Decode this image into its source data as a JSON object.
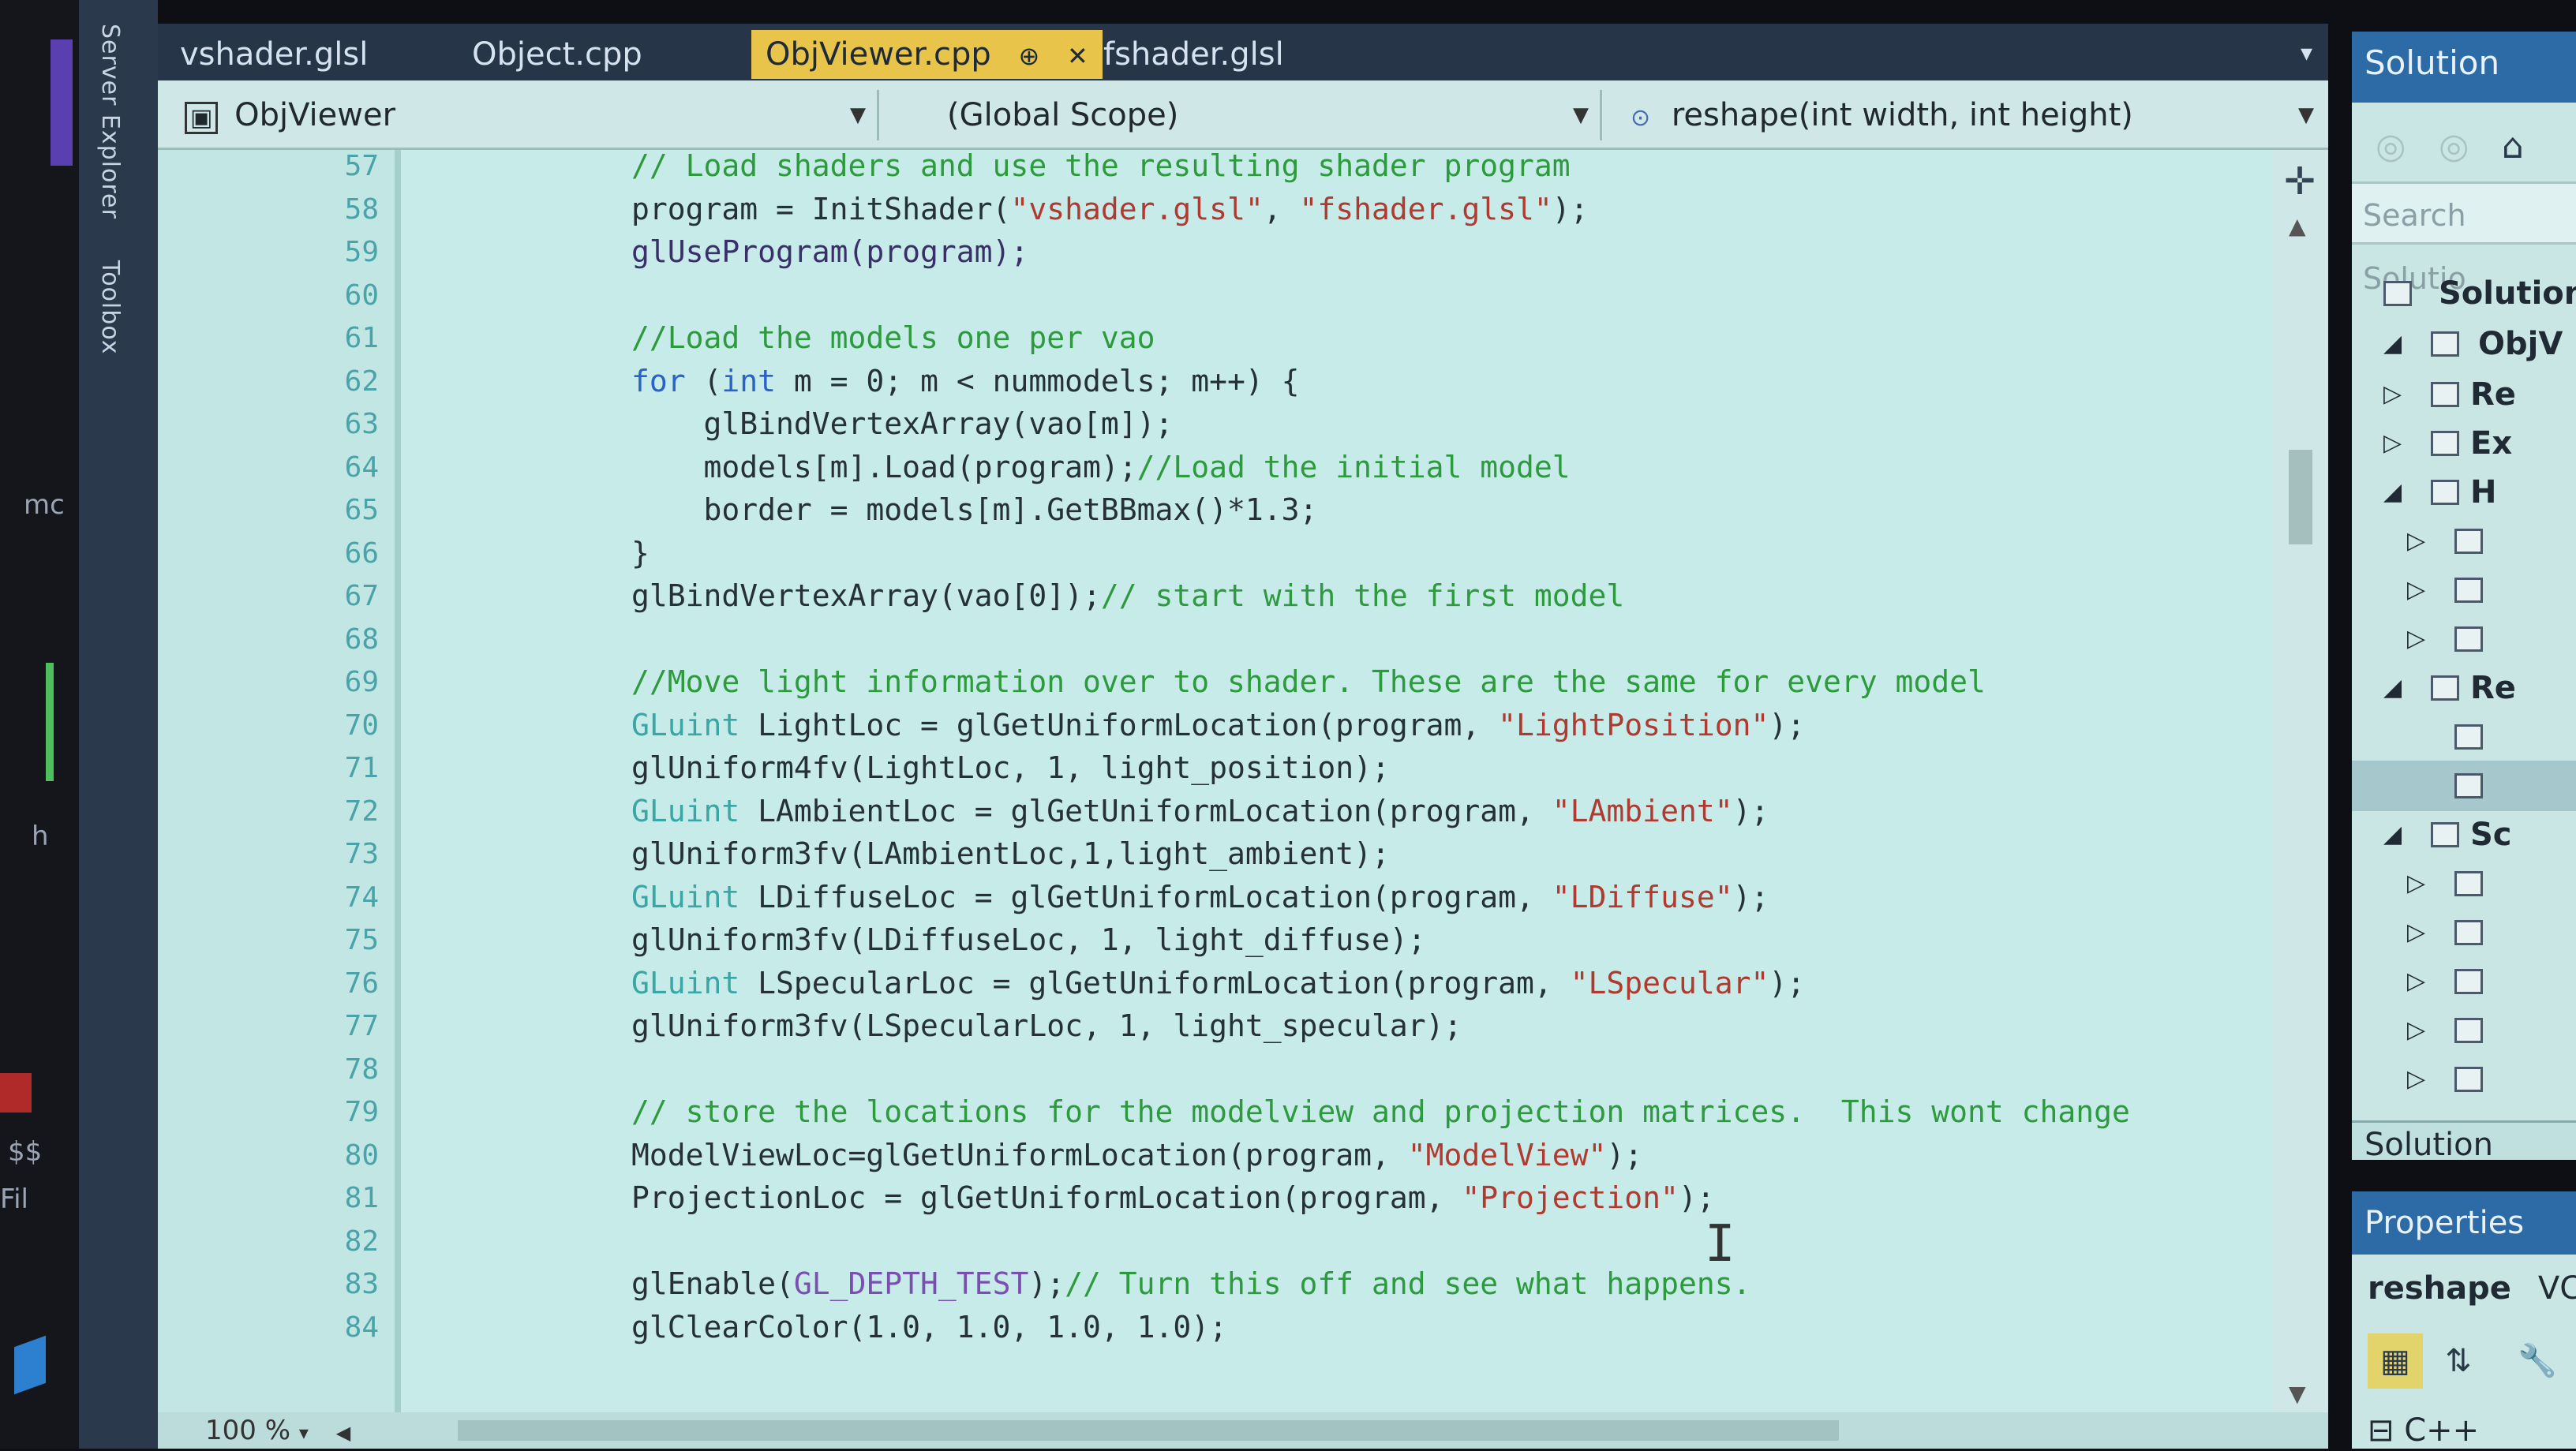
{
  "left_strip": {
    "text_mc": "mc",
    "text_h": "h",
    "text_ss": "$$",
    "text_fil": "Fil"
  },
  "side_tabs": {
    "server_explorer": "Server Explorer",
    "toolbox": "Toolbox"
  },
  "tabs": [
    {
      "label": "vshader.glsl"
    },
    {
      "label": "Object.cpp"
    },
    {
      "label": "ObjViewer.cpp",
      "pin": "⊕",
      "close": "✕"
    },
    {
      "label": "fshader.glsl"
    }
  ],
  "tab_overflow": "▾",
  "nav": {
    "project": "ObjViewer",
    "scope": "(Global Scope)",
    "member": "reshape(int width, int height)"
  },
  "editor": {
    "lines": [
      {
        "num": "57",
        "segments": [
          {
            "t": "// Load shaders and use the resulting shader program",
            "c": "cm"
          }
        ]
      },
      {
        "num": "58",
        "segments": [
          {
            "t": "program = InitShader(",
            "c": ""
          },
          {
            "t": "\"vshader.glsl\"",
            "c": "st"
          },
          {
            "t": ", ",
            "c": ""
          },
          {
            "t": "\"fshader.glsl\"",
            "c": "st"
          },
          {
            "t": ");",
            "c": ""
          }
        ]
      },
      {
        "num": "59",
        "segments": [
          {
            "t": "glUseProgram(program);",
            "c": "fn"
          }
        ]
      },
      {
        "num": "60",
        "segments": []
      },
      {
        "num": "61",
        "segments": [
          {
            "t": "//Load the models one per vao",
            "c": "cm"
          }
        ]
      },
      {
        "num": "62",
        "segments": [
          {
            "t": "for",
            "c": "kw"
          },
          {
            "t": " (",
            "c": ""
          },
          {
            "t": "int",
            "c": "kw"
          },
          {
            "t": " m = 0; m < nummodels; m++) {",
            "c": ""
          }
        ]
      },
      {
        "num": "63",
        "segments": [
          {
            "t": "    glBindVertexArray(vao[m]);",
            "c": ""
          }
        ]
      },
      {
        "num": "64",
        "segments": [
          {
            "t": "    models[m].Load(program);",
            "c": ""
          },
          {
            "t": "//Load the initial model",
            "c": "cm"
          }
        ]
      },
      {
        "num": "65",
        "segments": [
          {
            "t": "    border = models[m].GetBBmax()*1.3;",
            "c": ""
          }
        ]
      },
      {
        "num": "66",
        "segments": [
          {
            "t": "}",
            "c": ""
          }
        ]
      },
      {
        "num": "67",
        "segments": [
          {
            "t": "glBindVertexArray(vao[0]);",
            "c": ""
          },
          {
            "t": "// start with the first model",
            "c": "cm"
          }
        ]
      },
      {
        "num": "68",
        "segments": []
      },
      {
        "num": "69",
        "segments": [
          {
            "t": "//Move light information over to shader. These are the same for every model",
            "c": "cm"
          }
        ]
      },
      {
        "num": "70",
        "segments": [
          {
            "t": "GLuint",
            "c": "ty"
          },
          {
            "t": " LightLoc = glGetUniformLocation(program, ",
            "c": ""
          },
          {
            "t": "\"LightPosition\"",
            "c": "st"
          },
          {
            "t": ");",
            "c": ""
          }
        ]
      },
      {
        "num": "71",
        "segments": [
          {
            "t": "glUniform4fv(LightLoc, 1, light_position);",
            "c": ""
          }
        ]
      },
      {
        "num": "72",
        "segments": [
          {
            "t": "GLuint",
            "c": "ty"
          },
          {
            "t": " LAmbientLoc = glGetUniformLocation(program, ",
            "c": ""
          },
          {
            "t": "\"LAmbient\"",
            "c": "st"
          },
          {
            "t": ");",
            "c": ""
          }
        ]
      },
      {
        "num": "73",
        "segments": [
          {
            "t": "glUniform3fv(LAmbientLoc,1,light_ambient);",
            "c": ""
          }
        ]
      },
      {
        "num": "74",
        "segments": [
          {
            "t": "GLuint",
            "c": "ty"
          },
          {
            "t": " LDiffuseLoc = glGetUniformLocation(program, ",
            "c": ""
          },
          {
            "t": "\"LDiffuse\"",
            "c": "st"
          },
          {
            "t": ");",
            "c": ""
          }
        ]
      },
      {
        "num": "75",
        "segments": [
          {
            "t": "glUniform3fv(LDiffuseLoc, 1, light_diffuse);",
            "c": ""
          }
        ]
      },
      {
        "num": "76",
        "segments": [
          {
            "t": "GLuint",
            "c": "ty"
          },
          {
            "t": " LSpecularLoc = glGetUniformLocation(program, ",
            "c": ""
          },
          {
            "t": "\"LSpecular\"",
            "c": "st"
          },
          {
            "t": ");",
            "c": ""
          }
        ]
      },
      {
        "num": "77",
        "segments": [
          {
            "t": "glUniform3fv(LSpecularLoc, 1, light_specular);",
            "c": ""
          }
        ]
      },
      {
        "num": "78",
        "segments": []
      },
      {
        "num": "79",
        "segments": [
          {
            "t": "// store the locations for the modelview and projection matrices.  This wont change",
            "c": "cm"
          }
        ]
      },
      {
        "num": "80",
        "segments": [
          {
            "t": "ModelViewLoc=glGetUniformLocation(program, ",
            "c": ""
          },
          {
            "t": "\"ModelView\"",
            "c": "st"
          },
          {
            "t": ");",
            "c": ""
          }
        ]
      },
      {
        "num": "81",
        "segments": [
          {
            "t": "ProjectionLoc = glGetUniformLocation(program, ",
            "c": ""
          },
          {
            "t": "\"Projection\"",
            "c": "st"
          },
          {
            "t": ");",
            "c": ""
          }
        ]
      },
      {
        "num": "82",
        "segments": []
      },
      {
        "num": "83",
        "segments": [
          {
            "t": "glEnable(",
            "c": ""
          },
          {
            "t": "GL_DEPTH_TEST",
            "c": "mac"
          },
          {
            "t": ");",
            "c": ""
          },
          {
            "t": "// Turn this off and see what happens.",
            "c": "cm"
          }
        ]
      },
      {
        "num": "84",
        "segments": [
          {
            "t": "glClearColor(1.0, 1.0, 1.0, 1.0);",
            "c": ""
          }
        ]
      }
    ]
  },
  "status": {
    "zoom": "100 %"
  },
  "solution_explorer": {
    "title": "Solution Explo",
    "search_placeholder": "Search Solutio",
    "solution_label": "Solution",
    "project_label": "ObjV",
    "items": [
      "Re",
      "Ex",
      "H",
      "",
      "",
      "",
      "Re",
      "",
      "",
      "Sc",
      "",
      "",
      "",
      "",
      ""
    ],
    "footer": "Solution Explo"
  },
  "properties": {
    "title": "Properties",
    "object": "reshape",
    "object_type": "VCC",
    "category": "C++"
  },
  "colors": {
    "active_tab": "#e8c44a",
    "panel_title": "#2d6ba6",
    "editor_bg": "#c6ebe8",
    "comment": "#2e9a3e",
    "keyword": "#2a63c8",
    "string": "#b03a30"
  }
}
